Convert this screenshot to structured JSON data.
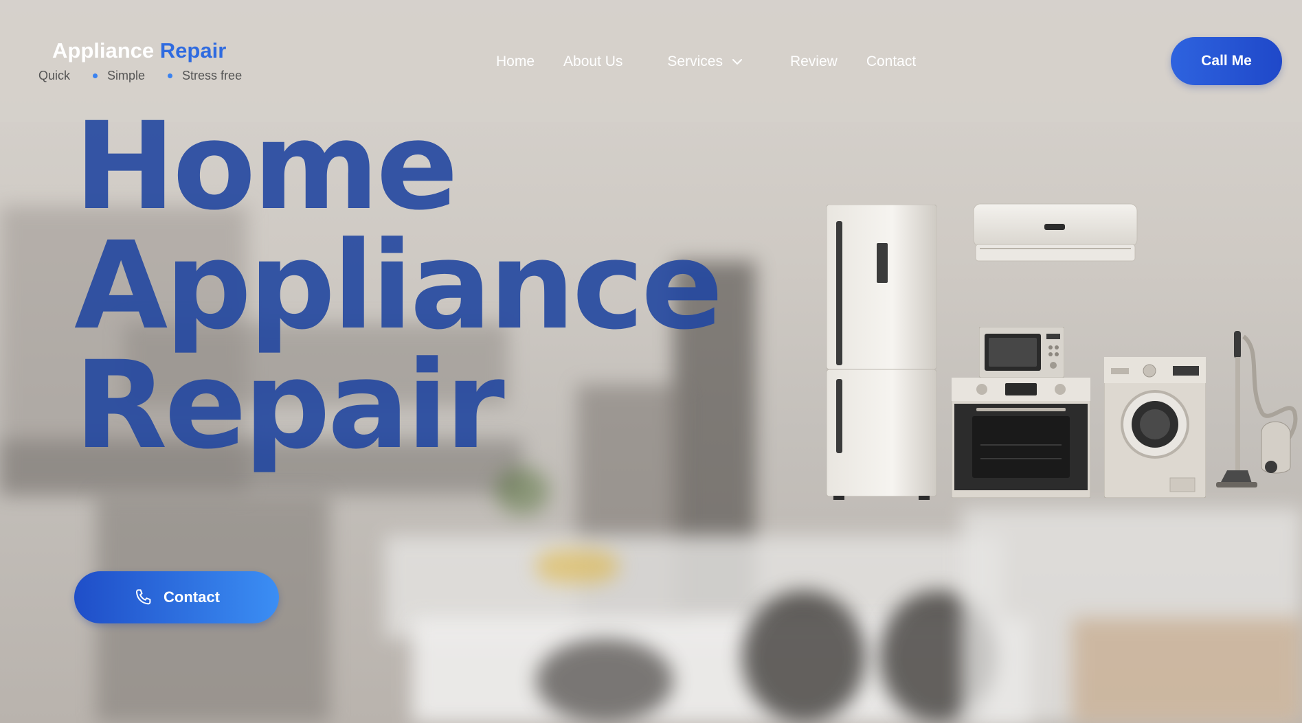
{
  "header": {
    "logo": {
      "word1": "Appliance",
      "word2": "Repair"
    },
    "tagline": [
      "Quick",
      "Simple",
      "Stress free"
    ],
    "nav": {
      "home": "Home",
      "about": "About Us",
      "services": "Services",
      "review": "Review",
      "contact": "Contact"
    },
    "cta": "Call Me"
  },
  "hero": {
    "line1": "Home",
    "line2": "Appliance",
    "line3": "Repair",
    "button": "Contact"
  },
  "colors": {
    "accent": "#2f6be0",
    "hero_text": "#2247a0",
    "button_gradient_start": "#1f4ec8",
    "button_gradient_end": "#3b8ef4"
  },
  "icons": {
    "services_dropdown": "chevron-down-icon",
    "contact_button": "phone-icon"
  }
}
